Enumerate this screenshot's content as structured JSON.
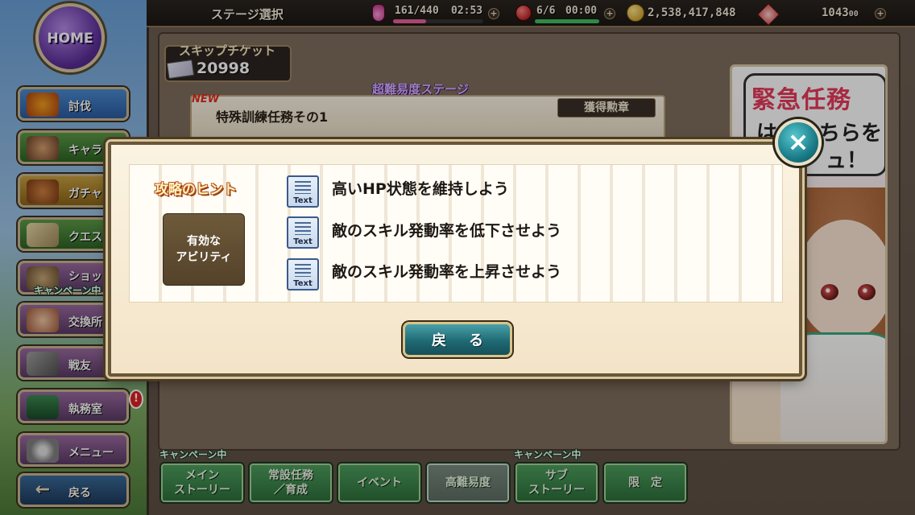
{
  "top_bar": {
    "screen_title": "ステージ選択",
    "stamina": "161/440",
    "stamina_timer": "02:53",
    "stamina_fraction": 0.366,
    "orbs": "6/6",
    "orb_timer": "00:00",
    "gold": "2,538,417,848",
    "gems": "1043",
    "gems_suffix": "00"
  },
  "home_button": "HOME",
  "side_menu": {
    "items": [
      {
        "label": "討伐",
        "icon": "bee-icon"
      },
      {
        "label": "キャラ",
        "icon": "characters-icon"
      },
      {
        "label": "ガチャ",
        "icon": "pot-icon"
      },
      {
        "label": "クエスト",
        "icon": "scroll-icon"
      },
      {
        "label": "ショップ",
        "icon": "bag-icon",
        "tag": "キャンペーン中"
      },
      {
        "label": "交換所",
        "icon": "girl-icon"
      },
      {
        "label": "戦友",
        "icon": "swords-icon"
      },
      {
        "label": "執務室",
        "icon": "office-icon",
        "badge": "!"
      },
      {
        "label": "メニュー",
        "icon": "gear-icon"
      },
      {
        "label": "戻る",
        "icon": "back-arrow-icon"
      }
    ]
  },
  "skip_ticket": {
    "label": "スキップチケット",
    "count": "20998"
  },
  "stage": {
    "difficulty_header": "超難易度ステージ",
    "new_tag": "NEW",
    "name": "特殊訓練任務その1",
    "medal_label": "獲得勲章"
  },
  "promo": {
    "title": "緊急任務",
    "line1": "は　こちらを",
    "line2": "ュ！"
  },
  "modal": {
    "title": "攻略のヒント",
    "ability_label_line1": "有効な",
    "ability_label_line2": "アビリティ",
    "icon_text": "Text",
    "hints": [
      "高いHP状態を維持しよう",
      "敵のスキル発動率を低下させよう",
      "敵のスキル発動率を上昇させよう"
    ],
    "back_button": "戻る",
    "close_icon": "×"
  },
  "bottom_tabs": {
    "campaign_tag": "キャンペーン中",
    "tabs": [
      {
        "label": "メイン\nストーリー",
        "campaign": true
      },
      {
        "label": "常設任務\n／育成",
        "campaign": false
      },
      {
        "label": "イベント",
        "campaign": false
      },
      {
        "label": "高難易度",
        "campaign": false,
        "active": true
      },
      {
        "label": "サブ\nストーリー",
        "campaign": true
      },
      {
        "label": "限　定",
        "campaign": false
      }
    ]
  }
}
